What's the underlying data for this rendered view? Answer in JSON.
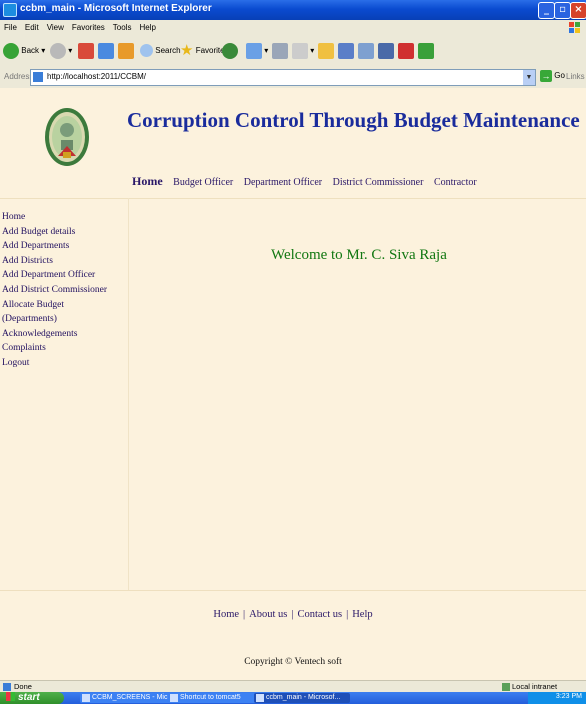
{
  "window": {
    "title": "ccbm_main - Microsoft Internet Explorer",
    "controls": [
      "_",
      "×"
    ]
  },
  "menu": [
    "File",
    "Edit",
    "View",
    "Favorites",
    "Tools",
    "Help"
  ],
  "toolbar": {
    "back_label": "Back",
    "search_label": "Search",
    "favorites_label": "Favorites"
  },
  "address": {
    "label": "Address",
    "url": "http://localhost:2011/CCBM/",
    "go_label": "Go",
    "links_label": "Links"
  },
  "site": {
    "title": "Corruption Control Through Budget Maintenance",
    "top_nav": [
      "Home",
      "Budget Officer",
      "Department Officer",
      "District Commissioner",
      "Contractor"
    ],
    "left_menu": [
      "Home",
      "Add Budget details",
      "Add Departments",
      "Add Districts",
      "Add Department Officer",
      "Add District Commissioner",
      "Allocate Budget",
      "(Departments)",
      "Acknowledgements",
      "Complaints",
      "Logout"
    ],
    "welcome": "Welcome to Mr. C. Siva Raja",
    "footer_nav": [
      "Home",
      "About us",
      "Contact us",
      "Help"
    ],
    "footer_sep": "|",
    "copyright": "Copyright © Ventech soft"
  },
  "status": {
    "text": "Done",
    "zone": "Local intranet"
  },
  "taskbar": {
    "start": "start",
    "tasks": [
      "CCBM_SCREENS - Mic...",
      "Shortcut to tomcat5",
      "ccbm_main - Microsof..."
    ],
    "time": "3:23 PM"
  },
  "colors": {
    "page_bg": "#fcf2dd",
    "title": "#1a2c9c",
    "welcome": "#117711",
    "links": "#2a1868"
  }
}
